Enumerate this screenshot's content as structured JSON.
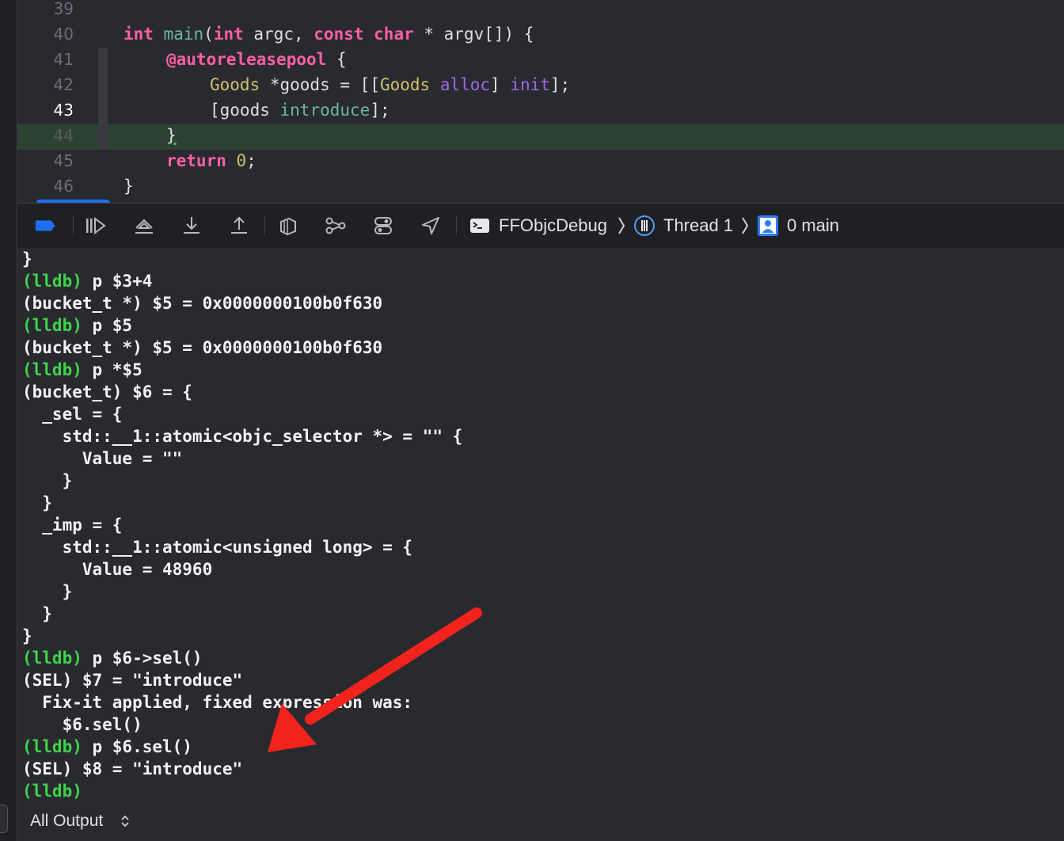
{
  "editor": {
    "lines": [
      {
        "num": "39"
      },
      {
        "num": "40"
      },
      {
        "num": "41"
      },
      {
        "num": "42"
      },
      {
        "num": "43"
      },
      {
        "num": "44"
      },
      {
        "num": "45"
      },
      {
        "num": "46"
      }
    ],
    "breakpoint_line": "43",
    "current_line": "44",
    "code": {
      "l40": {
        "int1": "int",
        "main": "main",
        "p1": "(",
        "int2": "int",
        "argc": " argc, ",
        "const": "const",
        "sp": " ",
        "char": "char",
        "rest": " * argv[]) {"
      },
      "l41": {
        "pool": "@autoreleasepool",
        "rest": " {"
      },
      "l42": {
        "goods_t": "Goods",
        "mid": " *goods = [[",
        "goods_c": "Goods",
        "sp": " ",
        "alloc": "alloc",
        "mid2": "] ",
        "init": "init",
        "end": "];"
      },
      "l43": {
        "a": "[goods ",
        "introduce": "introduce",
        "b": "];"
      },
      "l44": {
        "brace": "}"
      },
      "l45": {
        "return": "return",
        "sp": " ",
        "zero": "0",
        "end": ";"
      },
      "l46": {
        "brace": "}"
      }
    }
  },
  "toolbar": {
    "icons": [
      "breakpoints-toggle-icon",
      "continue-icon",
      "step-over-icon",
      "step-into-icon",
      "step-out-icon",
      "view-hierarchy-icon",
      "memory-graph-icon",
      "environment-overrides-icon",
      "simulate-location-icon"
    ],
    "process": "FFObjcDebug",
    "thread": "Thread 1",
    "frame": "0 main"
  },
  "console": {
    "lines": [
      {
        "prompt": "",
        "text": "}"
      },
      {
        "prompt": "(lldb)",
        "text": " p $3+4"
      },
      {
        "prompt": "",
        "text": "(bucket_t *) $5 = 0x0000000100b0f630"
      },
      {
        "prompt": "(lldb)",
        "text": " p $5"
      },
      {
        "prompt": "",
        "text": "(bucket_t *) $5 = 0x0000000100b0f630"
      },
      {
        "prompt": "(lldb)",
        "text": " p *$5"
      },
      {
        "prompt": "",
        "text": "(bucket_t) $6 = {"
      },
      {
        "prompt": "",
        "text": "  _sel = {"
      },
      {
        "prompt": "",
        "text": "    std::__1::atomic<objc_selector *> = \"\" {"
      },
      {
        "prompt": "",
        "text": "      Value = \"\""
      },
      {
        "prompt": "",
        "text": "    }"
      },
      {
        "prompt": "",
        "text": "  }"
      },
      {
        "prompt": "",
        "text": "  _imp = {"
      },
      {
        "prompt": "",
        "text": "    std::__1::atomic<unsigned long> = {"
      },
      {
        "prompt": "",
        "text": "      Value = 48960"
      },
      {
        "prompt": "",
        "text": "    }"
      },
      {
        "prompt": "",
        "text": "  }"
      },
      {
        "prompt": "",
        "text": "}"
      },
      {
        "prompt": "(lldb)",
        "text": " p $6->sel()"
      },
      {
        "prompt": "",
        "text": "(SEL) $7 = \"introduce\""
      },
      {
        "prompt": "",
        "text": "  Fix-it applied, fixed expression was:"
      },
      {
        "prompt": "",
        "text": "    $6.sel()"
      },
      {
        "prompt": "(lldb)",
        "text": " p $6.sel()"
      },
      {
        "prompt": "",
        "text": "(SEL) $8 = \"introduce\""
      },
      {
        "prompt": "(lldb)",
        "text": ""
      }
    ]
  },
  "footer": {
    "output_filter": "All Output"
  },
  "colors": {
    "background": "#292a30",
    "keyword": "#fc5fa3",
    "prompt": "#3dd44a",
    "breakpoint": "#1e6ff0",
    "current_line": "#2e4234",
    "annotation_arrow": "#f0241c"
  }
}
